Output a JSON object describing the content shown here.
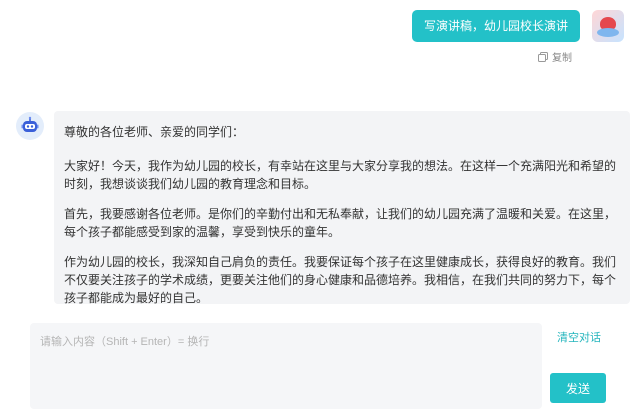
{
  "user_message": {
    "text": "写演讲稿，幼儿园校长演讲",
    "avatar_icon": "user-avatar-icon"
  },
  "copy_action": {
    "label": "复制",
    "icon": "copy-icon"
  },
  "bot_message": {
    "avatar_icon": "robot-icon",
    "paragraphs": [
      "尊敬的各位老师、亲爱的同学们：",
      "大家好！今天，我作为幼儿园的校长，有幸站在这里与大家分享我的想法。在这样一个充满阳光和希望的时刻，我想谈谈我们幼儿园的教育理念和目标。",
      "首先，我要感谢各位老师。是你们的辛勤付出和无私奉献，让我们的幼儿园充满了温暖和关爱。在这里，每个孩子都能感受到家的温馨，享受到快乐的童年。",
      "作为幼儿园的校长，我深知自己肩负的责任。我要保证每个孩子在这里健康成长，获得良好的教育。我们不仅要关注孩子的学术成绩，更要关注他们的身心健康和品德培养。我相信，在我们共同的努力下，每个孩子都能成为最好的自己。"
    ]
  },
  "composer": {
    "placeholder": "请输入内容（Shift + Enter）= 换行",
    "value": "",
    "clear_label": "清空对话",
    "send_label": "发送"
  },
  "colors": {
    "accent": "#23c1c8",
    "bubble_bg": "#f3f4f6",
    "input_bg": "#f5f6f8"
  }
}
